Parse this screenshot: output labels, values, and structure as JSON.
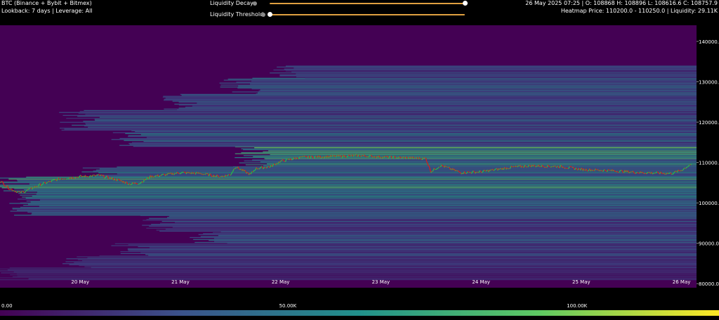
{
  "header": {
    "ticker": "BTC (Binance + Bybit + Bitmex)",
    "lookback": "Lookback: 7 days | Leverage: All",
    "ohlc": "26 May 2025 07:25 | O: 108868 H: 108896 L: 108616.6 C: 108757.9",
    "heatmap_info": "Heatmap Price: 110200.0 - 110250.0 | Liquidity: 29.11K"
  },
  "controls": {
    "decay_label": "Liquidity Decay",
    "decay_value": 1.0,
    "threshold_label": "Liquidity Threshold",
    "threshold_value": 0.0
  },
  "colors": {
    "background": "#000000",
    "accent": "#e0a040",
    "heat_low": "#440154",
    "heat_mid": "#21918c",
    "heat_high": "#fde725",
    "candle_up": "#2db34a",
    "candle_down": "#d02020"
  },
  "colorbar": {
    "labels": [
      "0.00",
      "50.00K",
      "100.00K"
    ],
    "values": [
      0,
      50000,
      100000
    ],
    "max": 125000
  },
  "chart_data": {
    "type": "heatmap",
    "title": "",
    "xlabel": "",
    "ylabel": "",
    "x_ticks": [
      "20 May",
      "21 May",
      "22 May",
      "23 May",
      "24 May",
      "25 May",
      "26 May"
    ],
    "y_ticks": [
      "140000.0",
      "130000.0",
      "120000.0",
      "110000.0",
      "100000.0",
      "90000.0",
      "80000.0"
    ],
    "y_tick_values": [
      140000,
      130000,
      120000,
      110000,
      100000,
      90000,
      80000
    ],
    "ylim": [
      79000,
      144000
    ],
    "xlim_days": [
      19.2,
      26.15
    ],
    "price_series": {
      "name": "",
      "days": [
        19.2,
        19.3,
        19.4,
        19.45,
        19.6,
        19.8,
        20.0,
        20.2,
        20.4,
        20.5,
        20.6,
        20.7,
        20.8,
        21.0,
        21.2,
        21.4,
        21.5,
        21.55,
        21.7,
        21.75,
        21.9,
        22.0,
        22.2,
        22.5,
        22.8,
        23.0,
        23.2,
        23.45,
        23.5,
        23.6,
        23.8,
        24.0,
        24.3,
        24.5,
        24.8,
        25.0,
        25.3,
        25.6,
        25.9,
        26.0,
        26.1
      ],
      "prices": [
        105500,
        103500,
        102500,
        102900,
        104500,
        106000,
        106500,
        106800,
        105500,
        104700,
        105000,
        106500,
        106800,
        107500,
        107300,
        106500,
        107000,
        109000,
        107000,
        108500,
        109000,
        110300,
        111300,
        111500,
        111700,
        111400,
        111200,
        111000,
        107800,
        109300,
        107500,
        107700,
        108800,
        109200,
        109000,
        108300,
        108000,
        107500,
        107300,
        108100,
        109700
      ]
    },
    "liquidity_bands": [
      {
        "low": 81000,
        "high": 84000,
        "start_day": 19.3,
        "intensity": 0.15
      },
      {
        "low": 84000,
        "high": 87000,
        "start_day": 20.0,
        "intensity": 0.2
      },
      {
        "low": 87000,
        "high": 90000,
        "start_day": 20.5,
        "intensity": 0.25
      },
      {
        "low": 90000,
        "high": 93000,
        "start_day": 21.3,
        "intensity": 0.3
      },
      {
        "low": 93000,
        "high": 97000,
        "start_day": 20.8,
        "intensity": 0.3
      },
      {
        "low": 97000,
        "high": 100000,
        "start_day": 19.5,
        "intensity": 0.35
      },
      {
        "low": 100000,
        "high": 103000,
        "start_day": 19.4,
        "intensity": 0.4
      },
      {
        "low": 103000,
        "high": 106500,
        "start_day": 19.3,
        "intensity": 0.55
      },
      {
        "low": 106500,
        "high": 109000,
        "start_day": 20.2,
        "intensity": 0.45
      },
      {
        "low": 109000,
        "high": 111000,
        "start_day": 21.7,
        "intensity": 0.45
      },
      {
        "low": 111000,
        "high": 114000,
        "start_day": 21.7,
        "intensity": 0.6
      },
      {
        "low": 114000,
        "high": 118000,
        "start_day": 20.5,
        "intensity": 0.35
      },
      {
        "low": 118000,
        "high": 123000,
        "start_day": 20.0,
        "intensity": 0.3
      },
      {
        "low": 123000,
        "high": 127000,
        "start_day": 21.0,
        "intensity": 0.3
      },
      {
        "low": 127000,
        "high": 131000,
        "start_day": 21.6,
        "intensity": 0.35
      },
      {
        "low": 131000,
        "high": 134000,
        "start_day": 22.1,
        "intensity": 0.25
      }
    ]
  }
}
